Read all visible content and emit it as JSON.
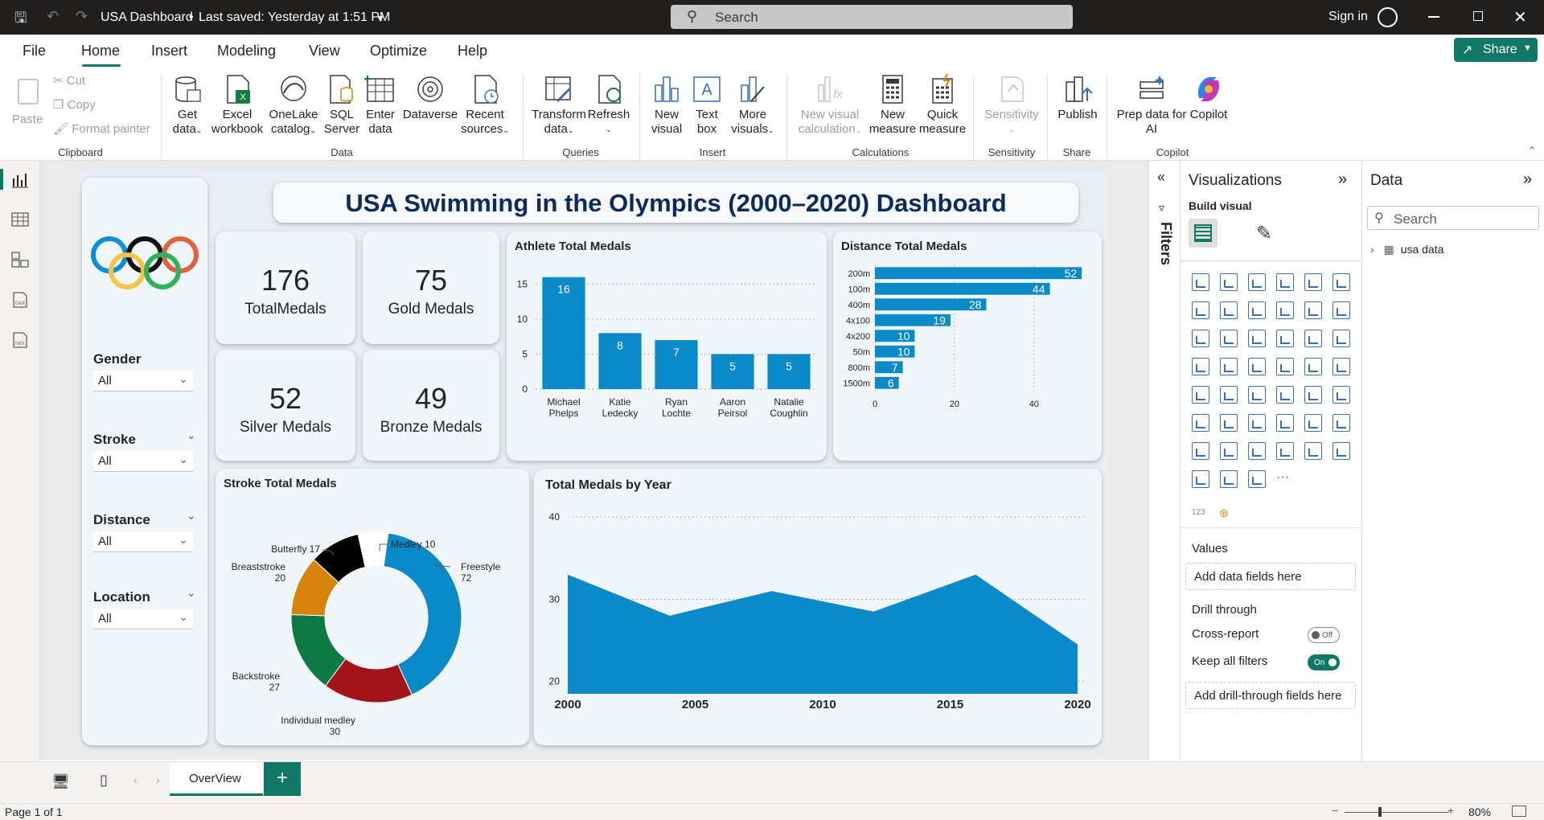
{
  "titlebar": {
    "title": "USA Dashboard",
    "saved": "Last saved: Yesterday at 1:51 PM",
    "search_placeholder": "Search",
    "sign_in": "Sign in"
  },
  "menu": [
    "File",
    "Home",
    "Insert",
    "Modeling",
    "View",
    "Optimize",
    "Help"
  ],
  "share_label": "Share",
  "ribbon": {
    "clipboard": {
      "paste": "Paste",
      "cut": "Cut",
      "copy": "Copy",
      "format_painter": "Format painter",
      "group": "Clipboard"
    },
    "data": {
      "get_data": [
        "Get",
        "data"
      ],
      "excel": [
        "Excel",
        "workbook"
      ],
      "onelake": [
        "OneLake",
        "catalog"
      ],
      "sql": [
        "SQL",
        "Server"
      ],
      "enter": [
        "Enter",
        "data"
      ],
      "dataverse": "Dataverse",
      "recent": [
        "Recent",
        "sources"
      ],
      "group": "Data"
    },
    "queries": {
      "transform": [
        "Transform",
        "data"
      ],
      "refresh": "Refresh",
      "group": "Queries"
    },
    "insert": {
      "new_visual": [
        "New",
        "visual"
      ],
      "text_box": [
        "Text",
        "box"
      ],
      "more_visuals": [
        "More",
        "visuals"
      ],
      "group": "Insert"
    },
    "calculations": {
      "new_visual_calc": [
        "New visual",
        "calculation"
      ],
      "new_measure": [
        "New",
        "measure"
      ],
      "quick_measure": [
        "Quick",
        "measure"
      ],
      "group": "Calculations"
    },
    "sensitivity": {
      "label": "Sensitivity",
      "group": "Sensitivity"
    },
    "share": {
      "publish": "Publish",
      "group": "Share"
    },
    "copilot": {
      "prep": [
        "Prep data for",
        "AI"
      ],
      "copilot": "Copilot",
      "group": "Copilot"
    }
  },
  "report": {
    "title": "USA Swimming in the Olympics (2000–2020) Dashboard",
    "kpis": [
      {
        "value": "176",
        "label": "TotalMedals"
      },
      {
        "value": "75",
        "label": "Gold Medals"
      },
      {
        "value": "52",
        "label": "Silver Medals"
      },
      {
        "value": "49",
        "label": "Bronze Medals"
      }
    ],
    "slicers": [
      {
        "title": "Gender",
        "value": "All"
      },
      {
        "title": "Stroke",
        "value": "All"
      },
      {
        "title": "Distance",
        "value": "All"
      },
      {
        "title": "Location",
        "value": "All"
      }
    ],
    "athlete_chart_title": "Athlete Total Medals",
    "distance_chart_title": "Distance Total Medals",
    "stroke_chart_title": "Stroke Total Medals",
    "year_chart_title": "Total Medals by Year"
  },
  "chart_data": [
    {
      "type": "bar",
      "title": "Athlete Total Medals",
      "categories": [
        "Michael Phelps",
        "Katie Ledecky",
        "Ryan Lochte",
        "Aaron Peirsol",
        "Natalie Coughlin"
      ],
      "values": [
        16,
        8,
        7,
        5,
        5
      ],
      "ylim": [
        0,
        17
      ],
      "yticks": [
        0,
        5,
        10,
        15
      ],
      "color": "#0a8ac8"
    },
    {
      "type": "bar",
      "orientation": "horizontal",
      "title": "Distance Total Medals",
      "categories": [
        "200m",
        "100m",
        "400m",
        "4x100",
        "4x200",
        "50m",
        "800m",
        "1500m"
      ],
      "values": [
        52,
        44,
        28,
        19,
        10,
        10,
        7,
        6
      ],
      "xlim": [
        0,
        55
      ],
      "xticks": [
        0,
        20,
        40
      ],
      "color": "#0a8ac8"
    },
    {
      "type": "pie",
      "title": "Stroke Total Medals",
      "categories": [
        "Freestyle",
        "Individual medley",
        "Backstroke",
        "Breaststroke",
        "Butterfly",
        "Medley"
      ],
      "values": [
        72,
        30,
        27,
        20,
        17,
        10
      ],
      "colors": [
        "#0a8ac8",
        "#a31419",
        "#0d7a46",
        "#d6840c",
        "#000000",
        "#ffffff"
      ]
    },
    {
      "type": "area",
      "title": "Total Medals by Year",
      "x": [
        2000,
        2004,
        2008,
        2012,
        2016,
        2020
      ],
      "values": [
        33,
        28,
        31,
        28.5,
        33,
        24.5
      ],
      "ylim": [
        18.5,
        41
      ],
      "yticks": [
        20,
        30,
        40
      ],
      "xticks": [
        2000,
        2005,
        2010,
        2015,
        2020
      ],
      "color": "#0a8ac8"
    }
  ],
  "footer": {
    "tab": "OverView",
    "status": "Page 1 of 1",
    "zoom": "80%"
  },
  "filters_label": "Filters",
  "viz_pane": {
    "title": "Visualizations",
    "build_visual": "Build visual",
    "values": "Values",
    "add_data": "Add data fields here",
    "drill_through": "Drill through",
    "cross_report": "Cross-report",
    "cross_report_state": "Off",
    "keep_filters": "Keep all filters",
    "keep_filters_state": "On",
    "add_drill": "Add drill-through fields here"
  },
  "data_pane": {
    "title": "Data",
    "search_placeholder": "Search",
    "table": "usa data"
  }
}
